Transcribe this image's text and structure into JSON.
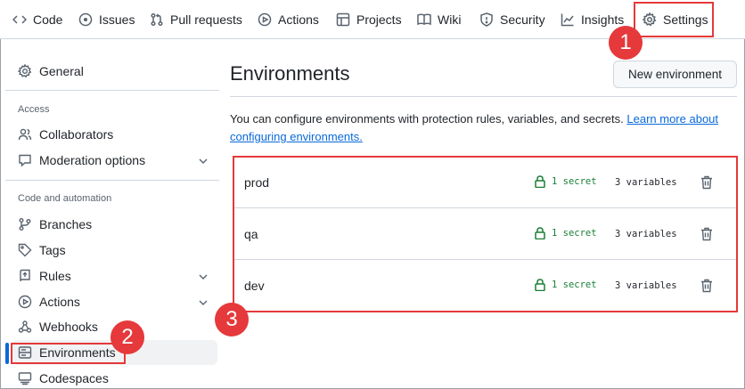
{
  "nav": {
    "tabs": [
      {
        "label": "Code",
        "icon": "code-icon"
      },
      {
        "label": "Issues",
        "icon": "issue-icon"
      },
      {
        "label": "Pull requests",
        "icon": "pull-request-icon"
      },
      {
        "label": "Actions",
        "icon": "play-icon"
      },
      {
        "label": "Projects",
        "icon": "table-icon"
      },
      {
        "label": "Wiki",
        "icon": "book-icon"
      },
      {
        "label": "Security",
        "icon": "shield-icon"
      },
      {
        "label": "Insights",
        "icon": "graph-icon"
      },
      {
        "label": "Settings",
        "icon": "gear-icon",
        "selected": true
      }
    ]
  },
  "sidebar": {
    "general": "General",
    "access_heading": "Access",
    "collaborators": "Collaborators",
    "moderation": "Moderation options",
    "code_heading": "Code and automation",
    "branches": "Branches",
    "tags": "Tags",
    "rules": "Rules",
    "actions": "Actions",
    "webhooks": "Webhooks",
    "environments": "Environments",
    "codespaces": "Codespaces"
  },
  "main": {
    "title": "Environments",
    "new_button": "New environment",
    "description": "You can configure environments with protection rules, variables, and secrets.",
    "learn_more": "Learn more about configuring environments.",
    "environments": [
      {
        "name": "prod",
        "secrets": "1 secret",
        "variables": "3 variables"
      },
      {
        "name": "qa",
        "secrets": "1 secret",
        "variables": "3 variables"
      },
      {
        "name": "dev",
        "secrets": "1 secret",
        "variables": "3 variables"
      }
    ]
  },
  "callouts": [
    "1",
    "2",
    "3"
  ],
  "colors": {
    "callout_red": "#e5393b",
    "link_blue": "#0969da",
    "secret_green": "#1a7f37",
    "active_bar": "#0969da"
  }
}
